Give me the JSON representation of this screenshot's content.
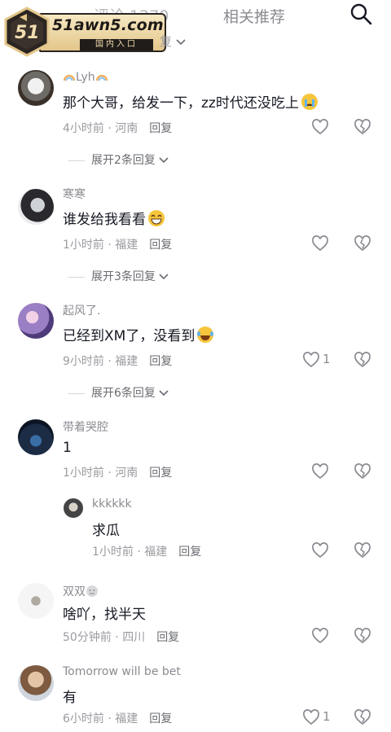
{
  "header": {
    "tab_comments": "评论 1270",
    "tab_related": "相关推荐",
    "search_icon": "search-icon",
    "banner_brand": "51awn5.com",
    "banner_entry": "国内入口",
    "banner_logo": "51",
    "banner_tail": "复"
  },
  "comments": [
    {
      "username": "Lyh",
      "text": "那个大哥，给发一下，zz时代还没吃上",
      "time": "4小时前",
      "location": "河南",
      "reply": "回复",
      "likes": "",
      "expand": "展开2条回复"
    },
    {
      "username": "寒寒",
      "text": "谁发给我看看",
      "time": "1小时前",
      "location": "福建",
      "reply": "回复",
      "likes": "",
      "expand": "展开3条回复"
    },
    {
      "username": "起风了.",
      "text": "已经到XM了，没看到",
      "time": "9小时前",
      "location": "福建",
      "reply": "回复",
      "likes": "1",
      "expand": "展开6条回复"
    },
    {
      "username": "带着哭腔",
      "text": "1",
      "time": "1小时前",
      "location": "河南",
      "reply": "回复",
      "likes": ""
    },
    {
      "username": "kkkkkk",
      "text": "求瓜",
      "time": "1小时前",
      "location": "福建",
      "reply": "回复",
      "likes": ""
    },
    {
      "username": "双双",
      "text": "啥吖，找半天",
      "time": "50分钟前",
      "location": "四川",
      "reply": "回复",
      "likes": ""
    },
    {
      "username": "Tomorrow will be bet",
      "text": "有",
      "time": "6小时前",
      "location": "福建",
      "reply": "回复",
      "likes": "1"
    }
  ],
  "colors": {
    "primary_text": "#161823",
    "secondary_text": "#8a8b91",
    "banner_gold": "#e3c68a"
  }
}
